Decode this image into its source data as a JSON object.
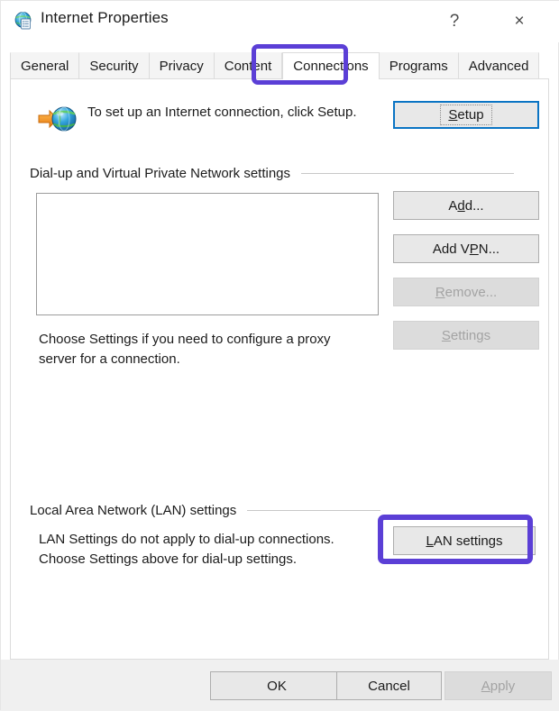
{
  "window": {
    "title": "Internet Properties",
    "icon": "internet-properties-icon",
    "help_label": "?",
    "close_label": "×"
  },
  "tabs": [
    {
      "label": "General",
      "selected": false
    },
    {
      "label": "Security",
      "selected": false
    },
    {
      "label": "Privacy",
      "selected": false
    },
    {
      "label": "Content",
      "selected": false
    },
    {
      "label": "Connections",
      "selected": true
    },
    {
      "label": "Programs",
      "selected": false
    },
    {
      "label": "Advanced",
      "selected": false
    }
  ],
  "connections": {
    "setup": {
      "icon": "globe-with-arrow-icon",
      "description": "To set up an Internet connection, click Setup.",
      "button_label": "Setup",
      "button_accel": "S",
      "button_focused": true
    },
    "dialup_group": {
      "header": "Dial-up and Virtual Private Network settings",
      "list_items": [],
      "buttons": [
        {
          "label": "Add...",
          "accel": "d",
          "disabled": false
        },
        {
          "label": "Add VPN...",
          "accel": "P",
          "disabled": false
        },
        {
          "label": "Remove...",
          "accel": "R",
          "disabled": true
        },
        {
          "label": "Settings",
          "accel": "S",
          "disabled": true
        }
      ],
      "hint": "Choose Settings if you need to configure a proxy server for a connection."
    },
    "lan_group": {
      "header": "Local Area Network (LAN) settings",
      "hint": "LAN Settings do not apply to dial-up connections. Choose Settings above for dial-up settings.",
      "button_label": "LAN settings",
      "button_accel": "L"
    }
  },
  "footer": {
    "ok_label": "OK",
    "cancel_label": "Cancel",
    "apply_label": "Apply",
    "apply_accel": "A",
    "apply_disabled": true
  },
  "annotations": {
    "color": "#5b3fd6",
    "targets": [
      "Connections",
      "LAN settings"
    ]
  }
}
